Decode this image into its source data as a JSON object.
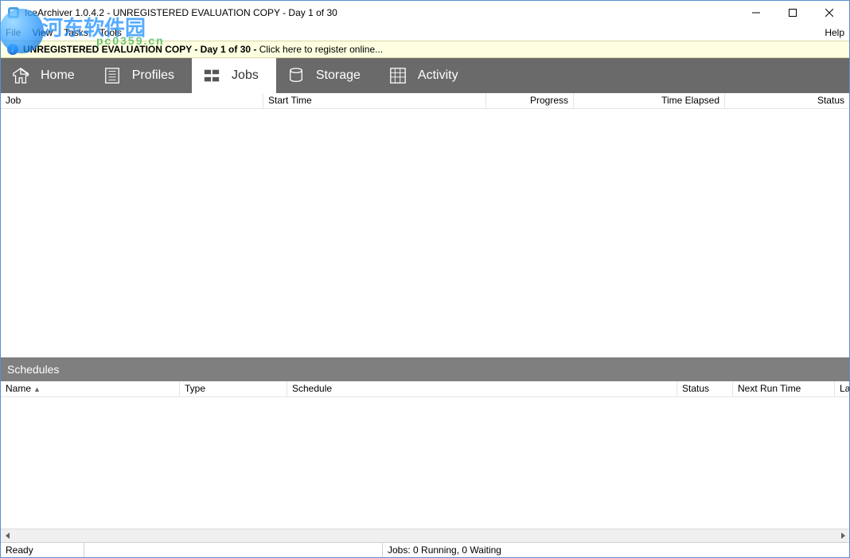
{
  "window": {
    "title": "IceArchiver 1.0.4.2 - UNREGISTERED EVALUATION COPY - Day 1 of 30"
  },
  "menubar": {
    "file": "File",
    "view": "View",
    "tasks": "Tasks",
    "tools": "Tools",
    "help": "Help"
  },
  "banner": {
    "bold": "UNREGISTERED EVALUATION COPY - Day 1 of 30 - ",
    "rest": "Click here to register online..."
  },
  "tabs": {
    "home": "Home",
    "profiles": "Profiles",
    "jobs": "Jobs",
    "storage": "Storage",
    "activity": "Activity"
  },
  "jobs_columns": {
    "job": "Job",
    "start_time": "Start Time",
    "progress": "Progress",
    "time_elapsed": "Time Elapsed",
    "status": "Status"
  },
  "schedules": {
    "title": "Schedules",
    "columns": {
      "name": "Name",
      "type": "Type",
      "schedule": "Schedule",
      "status": "Status",
      "next_run": "Next Run Time",
      "last": "La"
    }
  },
  "statusbar": {
    "ready": "Ready",
    "jobs": "Jobs: 0 Running, 0 Waiting"
  },
  "watermark": {
    "line1": "河东软件园",
    "line2": "pc0359.cn"
  }
}
